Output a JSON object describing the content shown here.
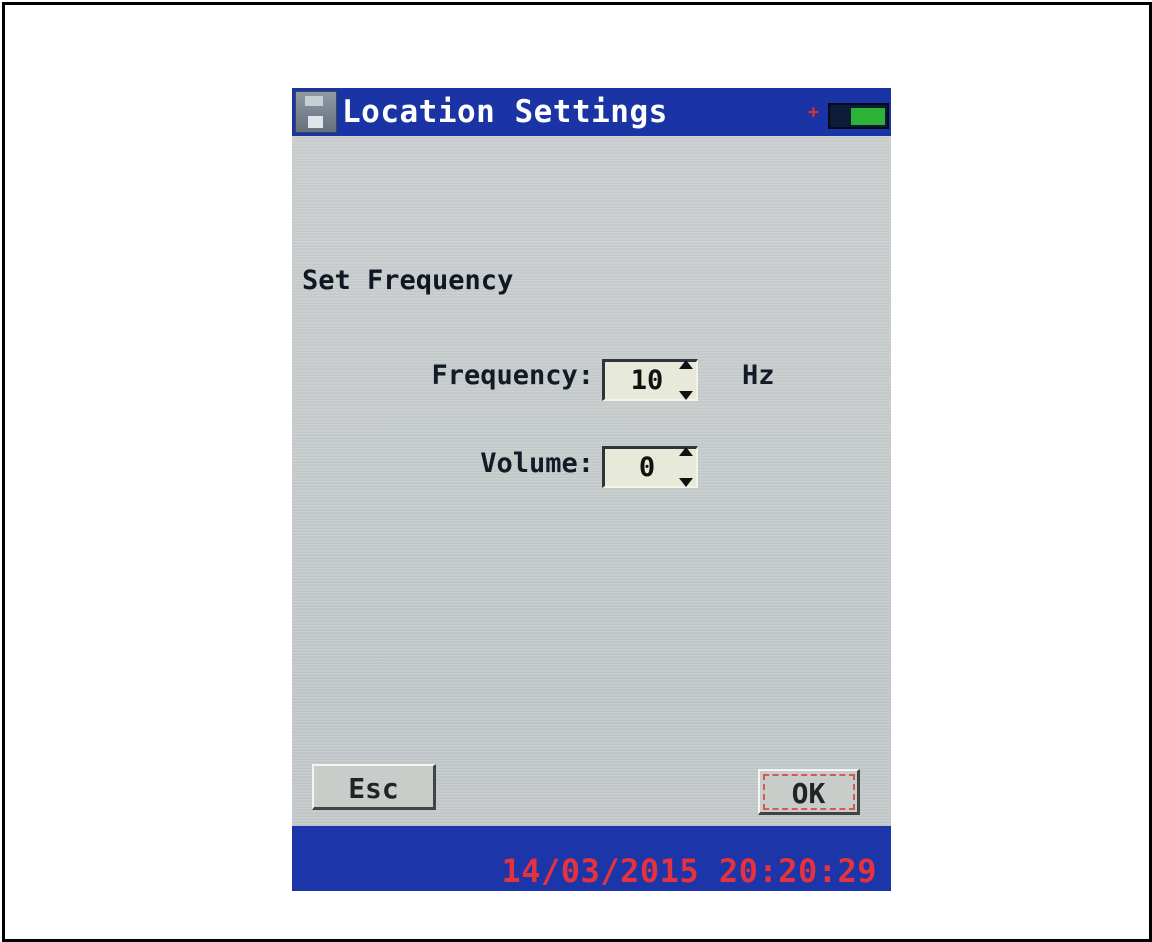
{
  "window": {
    "title": "Location Settings",
    "icon": "floppy-disk-icon"
  },
  "status_icons": {
    "charge": "+",
    "battery_icon": "battery-icon",
    "battery_level": 0.6
  },
  "section": {
    "title": "Set Frequency"
  },
  "fields": {
    "frequency": {
      "label": "Frequency:",
      "value": "10",
      "unit": "Hz"
    },
    "volume": {
      "label": "Volume:",
      "value": "0"
    }
  },
  "buttons": {
    "esc": "Esc",
    "ok": "OK"
  },
  "status_bar": {
    "datetime": "14/03/2015 20:20:29"
  },
  "colors": {
    "title_bar": "#1a34a6",
    "screen_background": "#c9cecf",
    "datetime_text": "#e4333e",
    "battery_fill": "#2cb236"
  }
}
